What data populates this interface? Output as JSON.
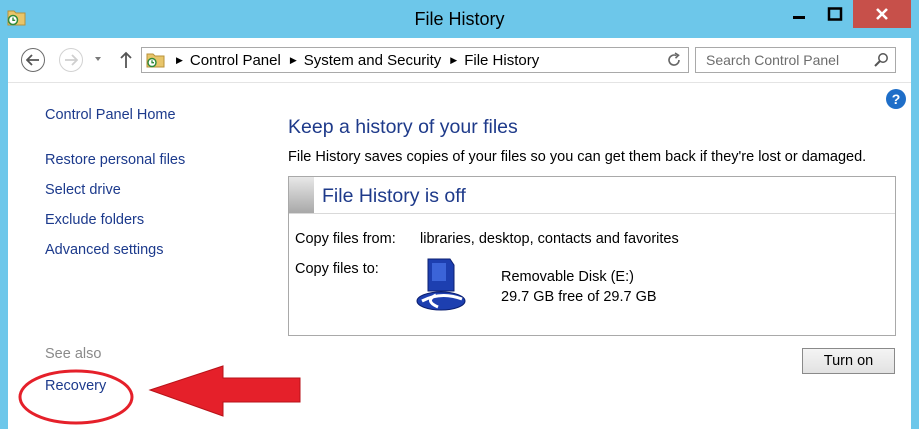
{
  "window": {
    "title": "File History",
    "title_icon": "folder-history-icon",
    "controls": [
      "minimize-icon",
      "maximize-icon",
      "close-icon"
    ]
  },
  "navbar": {
    "breadcrumb": [
      "Control Panel",
      "System and Security",
      "File History"
    ],
    "search": {
      "placeholder": "Search Control Panel"
    }
  },
  "sidebar": {
    "links": [
      "Control Panel Home",
      "Restore personal files",
      "Select drive",
      "Exclude folders",
      "Advanced settings"
    ],
    "see_also_label": "See also",
    "see_also_links": [
      "Recovery"
    ]
  },
  "main": {
    "heading": "Keep a history of your files",
    "description": "File History saves copies of your files so you can get them back if they're lost or damaged.",
    "status_title": "File History is off",
    "copy_from_label": "Copy files from:",
    "copy_from_value": "libraries, desktop, contacts and favorites",
    "copy_to_label": "Copy files to:",
    "drive_name": "Removable Disk (E:)",
    "drive_space": "29.7 GB free of 29.7 GB",
    "turn_on_label": "Turn on"
  },
  "colors": {
    "titlebar": "#6dc7ea",
    "link": "#1c3a8c",
    "heading": "#1e3a8a",
    "close_button": "#c7504a",
    "annotation": "#e5202a"
  }
}
